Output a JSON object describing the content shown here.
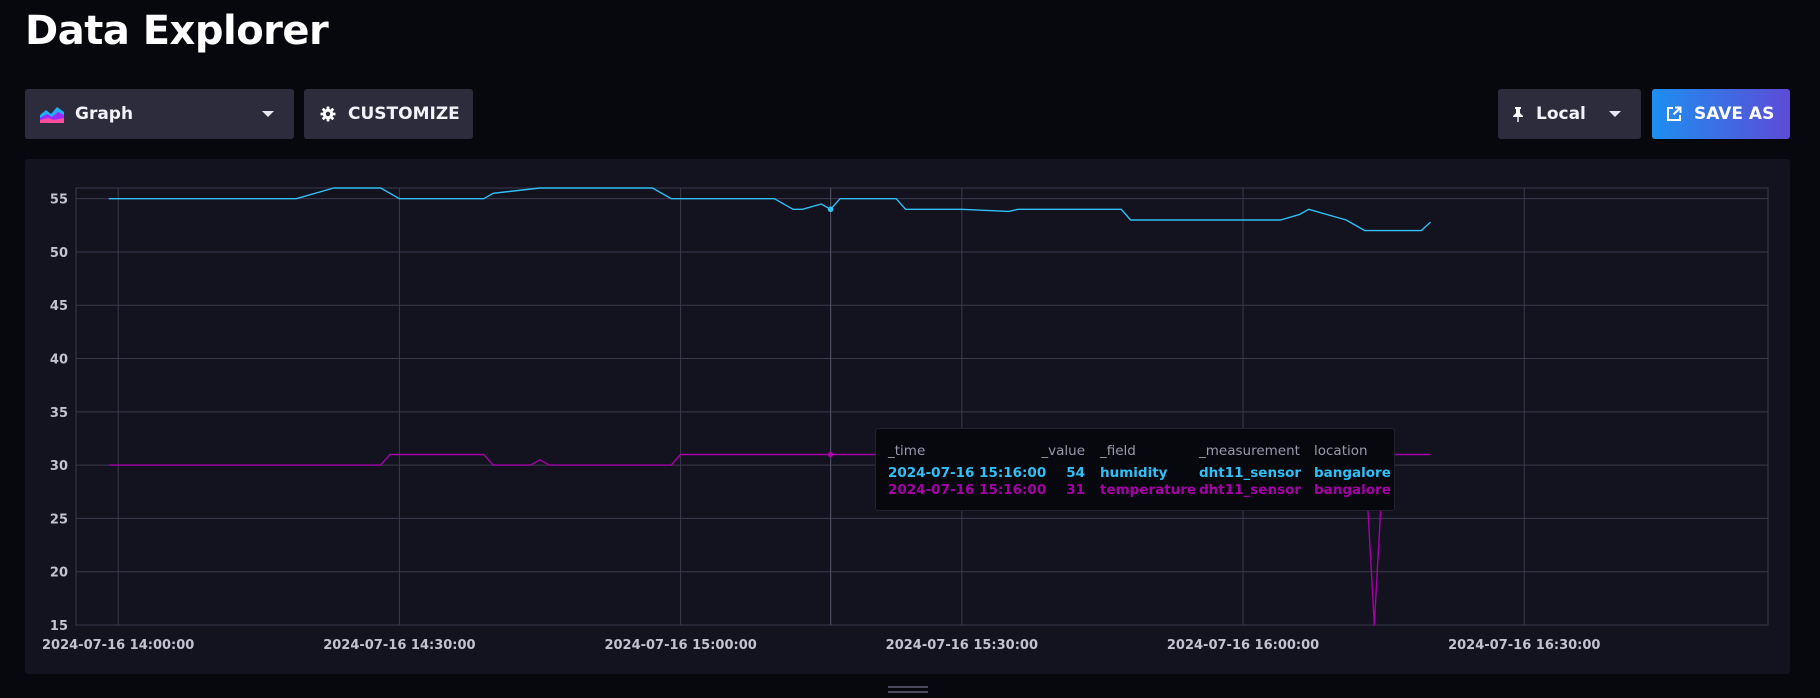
{
  "page": {
    "title": "Data Explorer"
  },
  "toolbar": {
    "graph_type": {
      "label": "Graph",
      "icon": "graph-icon"
    },
    "customize": {
      "label": "CUSTOMIZE",
      "icon": "gear-icon"
    },
    "timezone": {
      "label": "Local",
      "icon": "pin-icon"
    },
    "save_as": {
      "label": "SAVE AS",
      "icon": "external-link-icon"
    }
  },
  "colors": {
    "humidity": "#31c0f6",
    "temperature": "#a500a5",
    "panel_bg": "#131320",
    "grid": "#3a3a4c"
  },
  "tooltip": {
    "headers": [
      "_time",
      "_value",
      "_field",
      "_measurement",
      "location"
    ],
    "rows": [
      {
        "time": "2024-07-16 15:16:00",
        "value": "54",
        "field": "humidity",
        "measurement": "dht11_sensor",
        "location": "bangalore"
      },
      {
        "time": "2024-07-16 15:16:00",
        "value": "31",
        "field": "temperature",
        "measurement": "dht11_sensor",
        "location": "bangalore"
      }
    ]
  },
  "chart_data": {
    "type": "line",
    "y_ticks": [
      15,
      20,
      25,
      30,
      35,
      40,
      45,
      50,
      55
    ],
    "ylim": [
      15,
      56
    ],
    "x_ticks": [
      "2024-07-16 14:00:00",
      "2024-07-16 14:30:00",
      "2024-07-16 15:00:00",
      "2024-07-16 15:30:00",
      "2024-07-16 16:00:00",
      "2024-07-16 16:30:00"
    ],
    "xlim_minutes_after_14": [
      -4.5,
      176
    ],
    "hover_time": "2024-07-16 15:16:00",
    "grid": true,
    "series": [
      {
        "name": "humidity",
        "points": [
          [
            -1,
            55
          ],
          [
            19,
            55
          ],
          [
            23,
            56
          ],
          [
            28,
            56
          ],
          [
            30,
            55
          ],
          [
            39,
            55
          ],
          [
            40,
            55.5
          ],
          [
            45,
            56
          ],
          [
            57,
            56
          ],
          [
            59,
            55
          ],
          [
            70,
            55
          ],
          [
            72,
            54
          ],
          [
            73,
            54
          ],
          [
            75,
            54.5
          ],
          [
            76,
            54
          ],
          [
            77,
            55
          ],
          [
            83,
            55
          ],
          [
            84,
            54
          ],
          [
            90,
            54
          ],
          [
            95,
            53.8
          ],
          [
            96,
            54
          ],
          [
            107,
            54
          ],
          [
            108,
            53
          ],
          [
            124,
            53
          ],
          [
            126,
            53.5
          ],
          [
            127,
            54
          ],
          [
            131,
            53
          ],
          [
            133,
            52
          ],
          [
            138,
            52
          ],
          [
            139,
            52
          ],
          [
            140,
            52.8
          ]
        ]
      },
      {
        "name": "temperature",
        "points": [
          [
            -1,
            30
          ],
          [
            28,
            30
          ],
          [
            29,
            31
          ],
          [
            39,
            31
          ],
          [
            40,
            30
          ],
          [
            44,
            30
          ],
          [
            45,
            30.5
          ],
          [
            46,
            30
          ],
          [
            59,
            30
          ],
          [
            60,
            31
          ],
          [
            76,
            31
          ],
          [
            133,
            31
          ],
          [
            134,
            15
          ],
          [
            135,
            31
          ],
          [
            140,
            31
          ]
        ]
      }
    ]
  }
}
